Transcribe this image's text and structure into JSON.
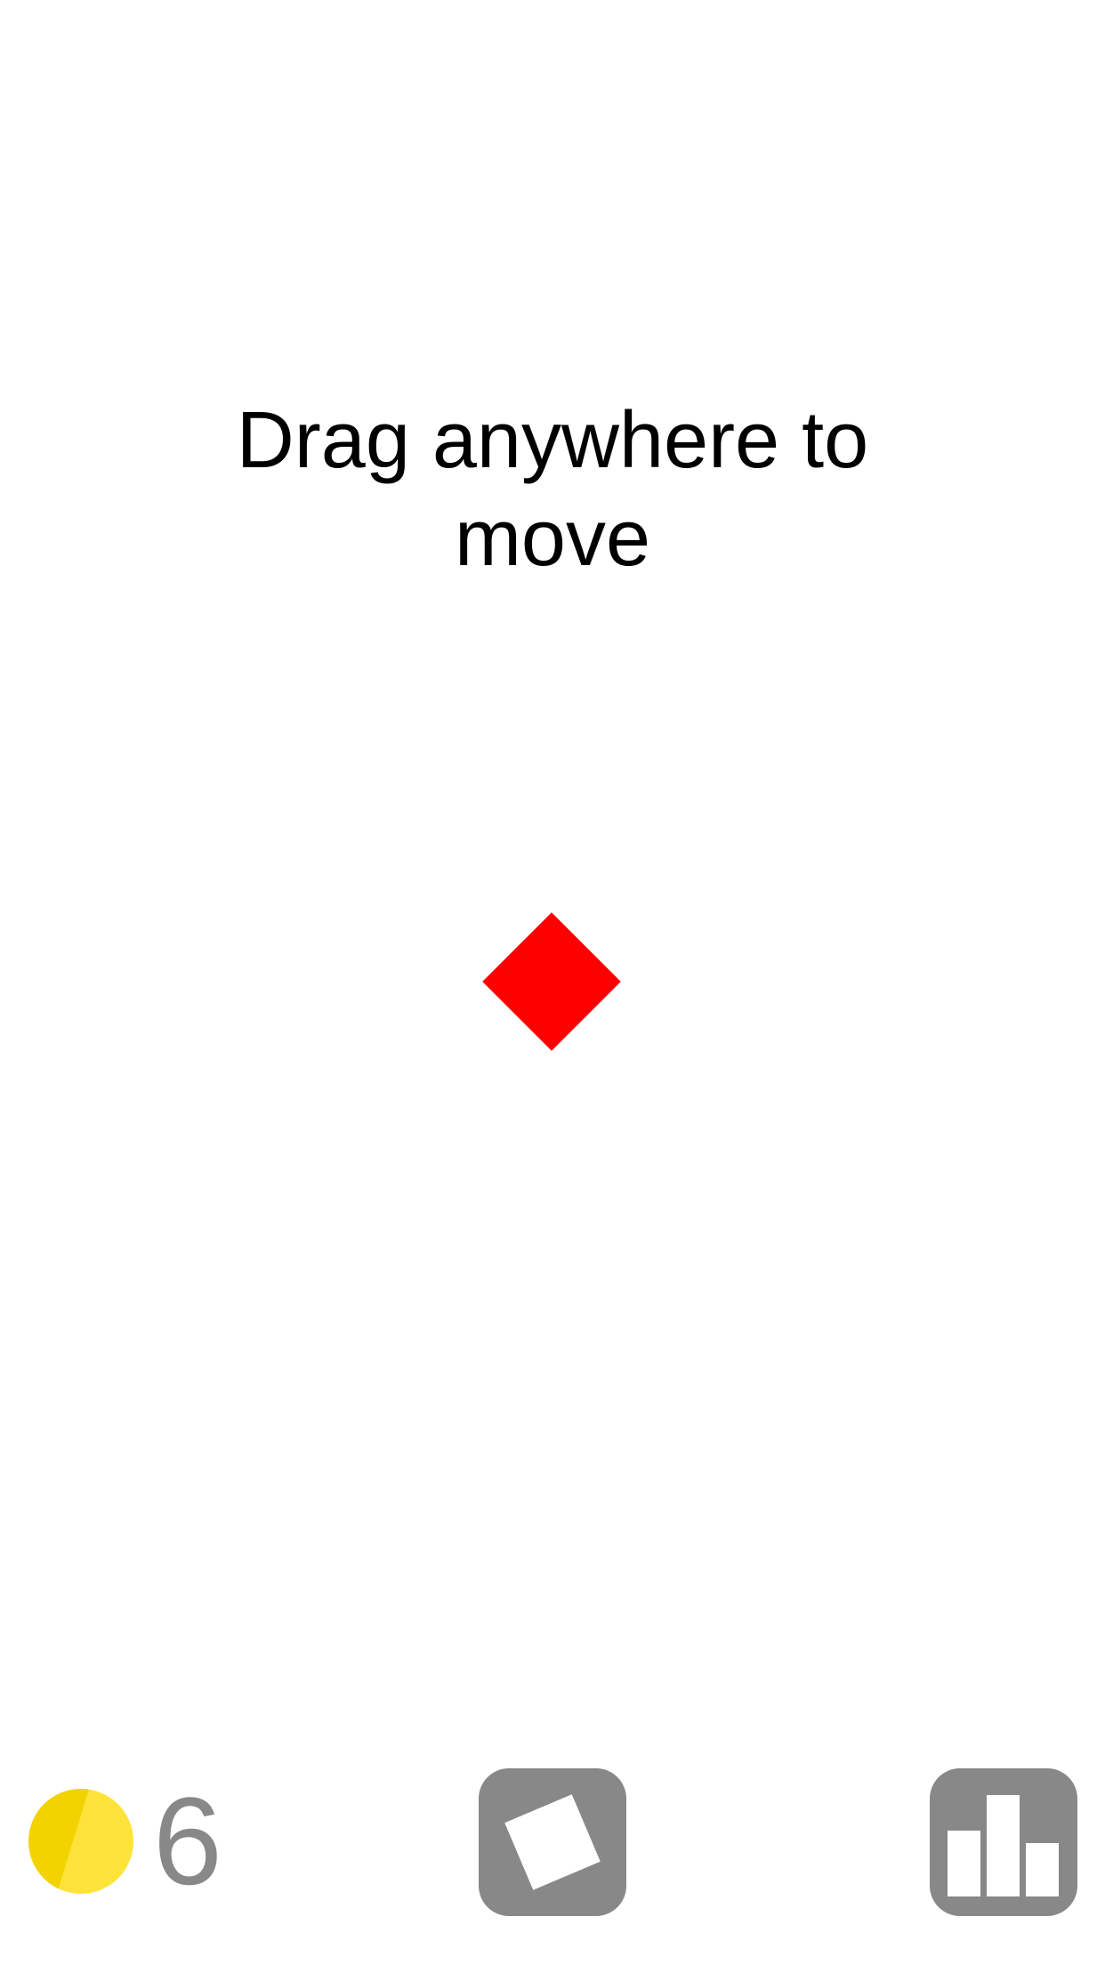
{
  "instruction": {
    "line1": "Drag anywhere to",
    "line2": "move"
  },
  "player": {
    "shape": "diamond",
    "color": "#ff0000"
  },
  "coins": {
    "count": "6",
    "icon": "coin-icon",
    "color_light": "#ffe33a",
    "color_dark": "#f2d300"
  },
  "buttons": {
    "skin": {
      "icon": "square-skin-icon",
      "color": "#888888"
    },
    "leaderboard": {
      "icon": "bar-chart-icon",
      "color": "#888888"
    }
  },
  "colors": {
    "background": "#ffffff",
    "text": "#000000",
    "muted": "#888888"
  }
}
